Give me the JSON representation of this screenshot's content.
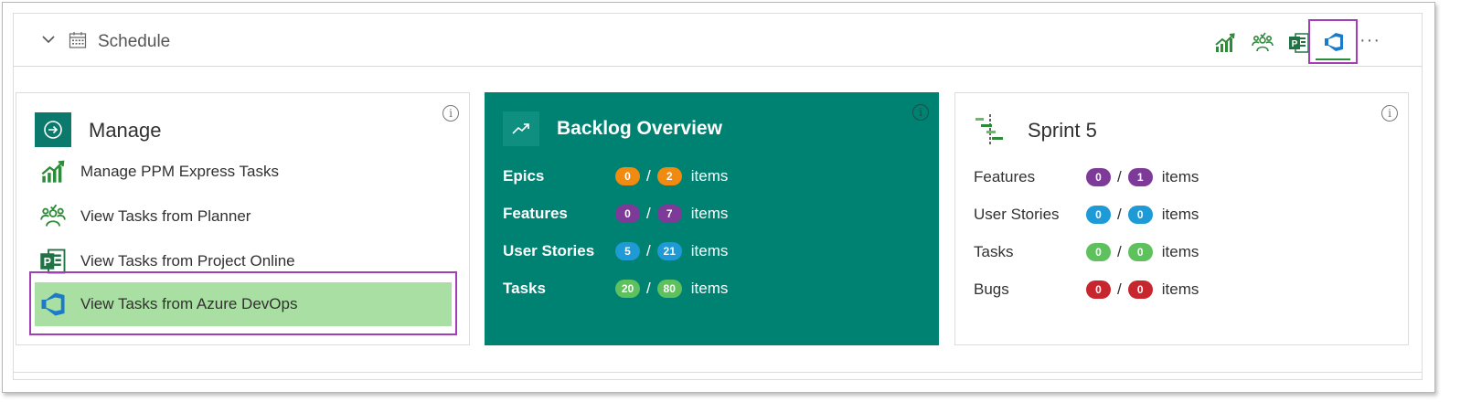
{
  "colors": {
    "teal": "#008272",
    "highlight": "#a9dfa3",
    "outline": "#a33fb6",
    "orange": "#f08a10",
    "purple": "#7d3a99",
    "blue": "#1e9ad6",
    "green": "#5ec15e",
    "red": "#c8262f"
  },
  "header": {
    "title": "Schedule",
    "more": "···",
    "toolbar_icons": [
      "chart-growth-icon",
      "team-icon",
      "project-online-icon",
      "azure-devops-icon"
    ]
  },
  "manage": {
    "title": "Manage",
    "info": "i",
    "items": [
      {
        "label": "Manage PPM Express Tasks",
        "icon": "chart-growth-icon"
      },
      {
        "label": "View Tasks from Planner",
        "icon": "team-icon"
      },
      {
        "label": "View Tasks from Project Online",
        "icon": "project-online-icon"
      },
      {
        "label": "View Tasks from Azure DevOps",
        "icon": "azure-devops-icon"
      }
    ]
  },
  "backlog": {
    "title": "Backlog Overview",
    "info": "i",
    "rows": [
      {
        "label": "Epics",
        "a": "0",
        "b": "2",
        "unit": "items",
        "color": "orange"
      },
      {
        "label": "Features",
        "a": "0",
        "b": "7",
        "unit": "items",
        "color": "purple"
      },
      {
        "label": "User Stories",
        "a": "5",
        "b": "21",
        "unit": "items",
        "color": "blue"
      },
      {
        "label": "Tasks",
        "a": "20",
        "b": "80",
        "unit": "items",
        "color": "green"
      }
    ]
  },
  "sprint": {
    "title": "Sprint 5",
    "info": "i",
    "rows": [
      {
        "label": "Features",
        "a": "0",
        "b": "1",
        "unit": "items",
        "color": "purple"
      },
      {
        "label": "User Stories",
        "a": "0",
        "b": "0",
        "unit": "items",
        "color": "blue"
      },
      {
        "label": "Tasks",
        "a": "0",
        "b": "0",
        "unit": "items",
        "color": "green"
      },
      {
        "label": "Bugs",
        "a": "0",
        "b": "0",
        "unit": "items",
        "color": "red"
      }
    ]
  }
}
